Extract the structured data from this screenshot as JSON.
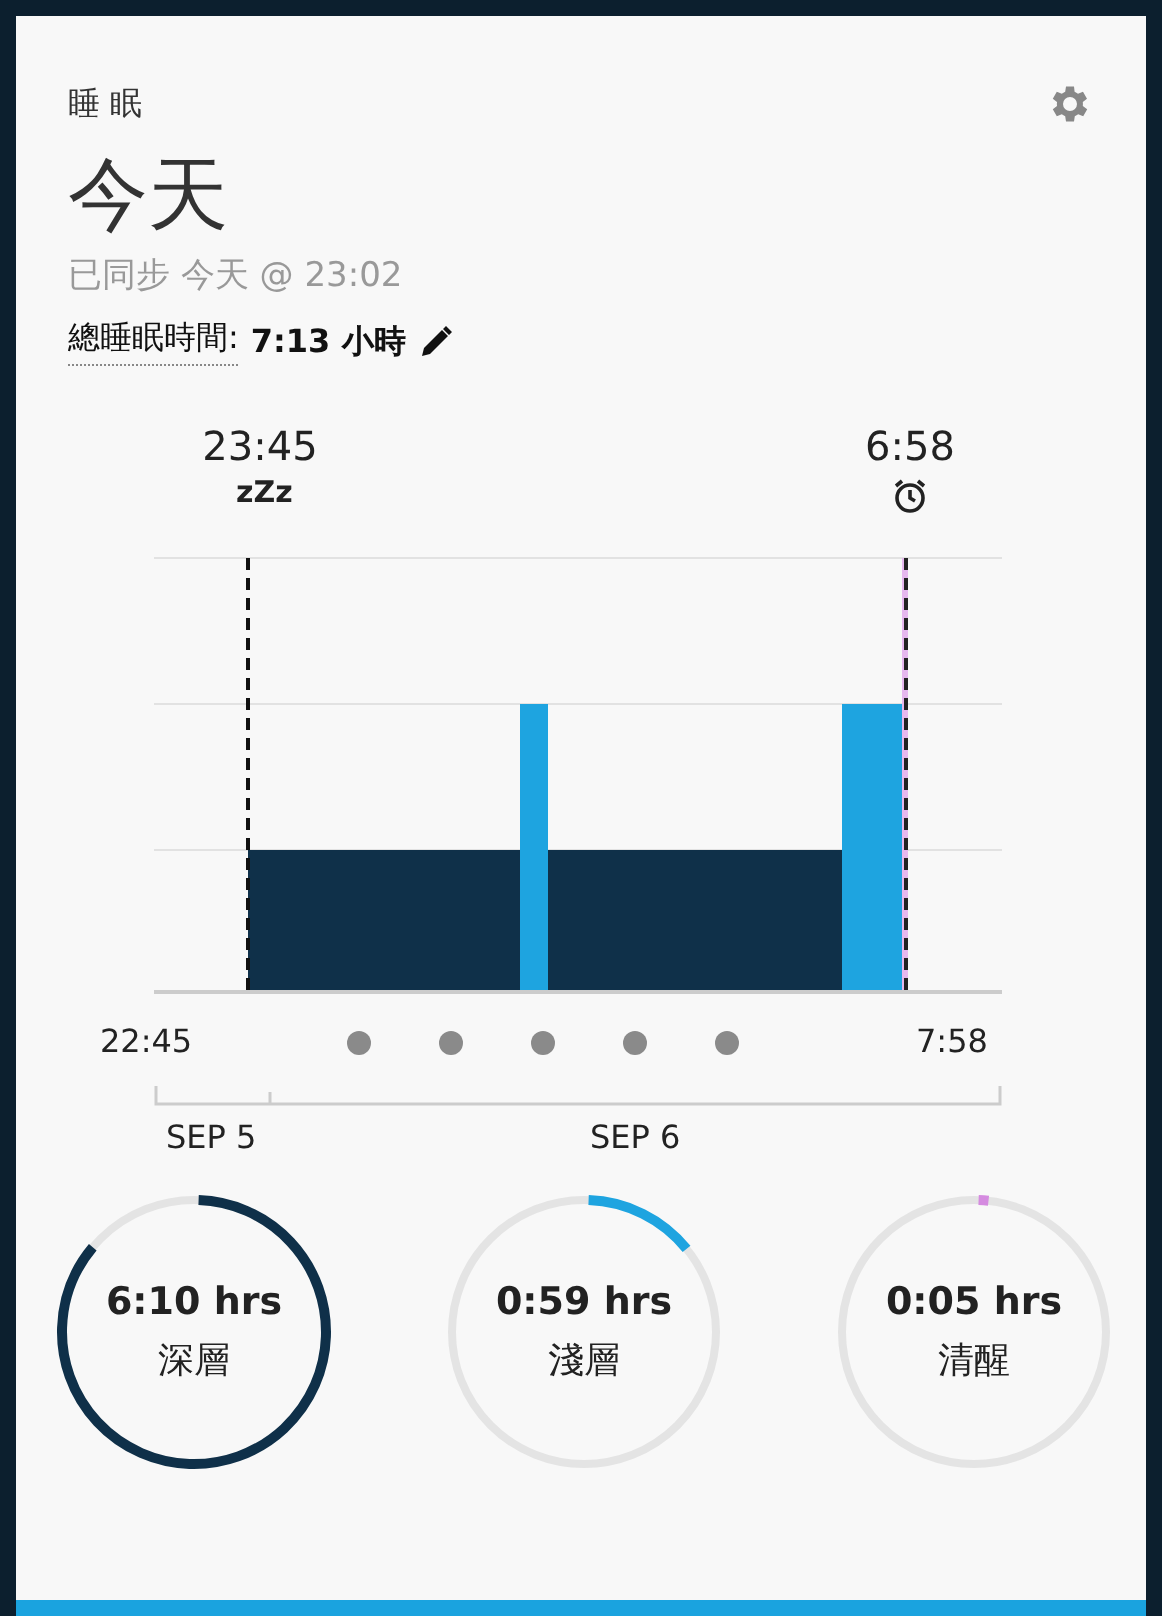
{
  "header": {
    "title": "睡 眠",
    "heading": "今天",
    "synced": "已同步 今天 @ 23:02",
    "total_label": "總睡眠時間:",
    "total_value": "7:13 小時"
  },
  "chart": {
    "sleep_time": "23:45",
    "sleep_mark": "zZz",
    "wake_time": "6:58",
    "start": "22:45",
    "end": "7:58",
    "dates": [
      "SEP 5",
      "SEP 6"
    ]
  },
  "stages": [
    {
      "value": "6:10 hrs",
      "label": "深層",
      "level": 0.855,
      "color": "#0f3049"
    },
    {
      "value": "0:59 hrs",
      "label": "淺層",
      "level": 0.136,
      "color": "#1ea4e0"
    },
    {
      "value": "0:05 hrs",
      "label": "清醒",
      "level": 0.012,
      "color": "#d58be0"
    }
  ]
}
